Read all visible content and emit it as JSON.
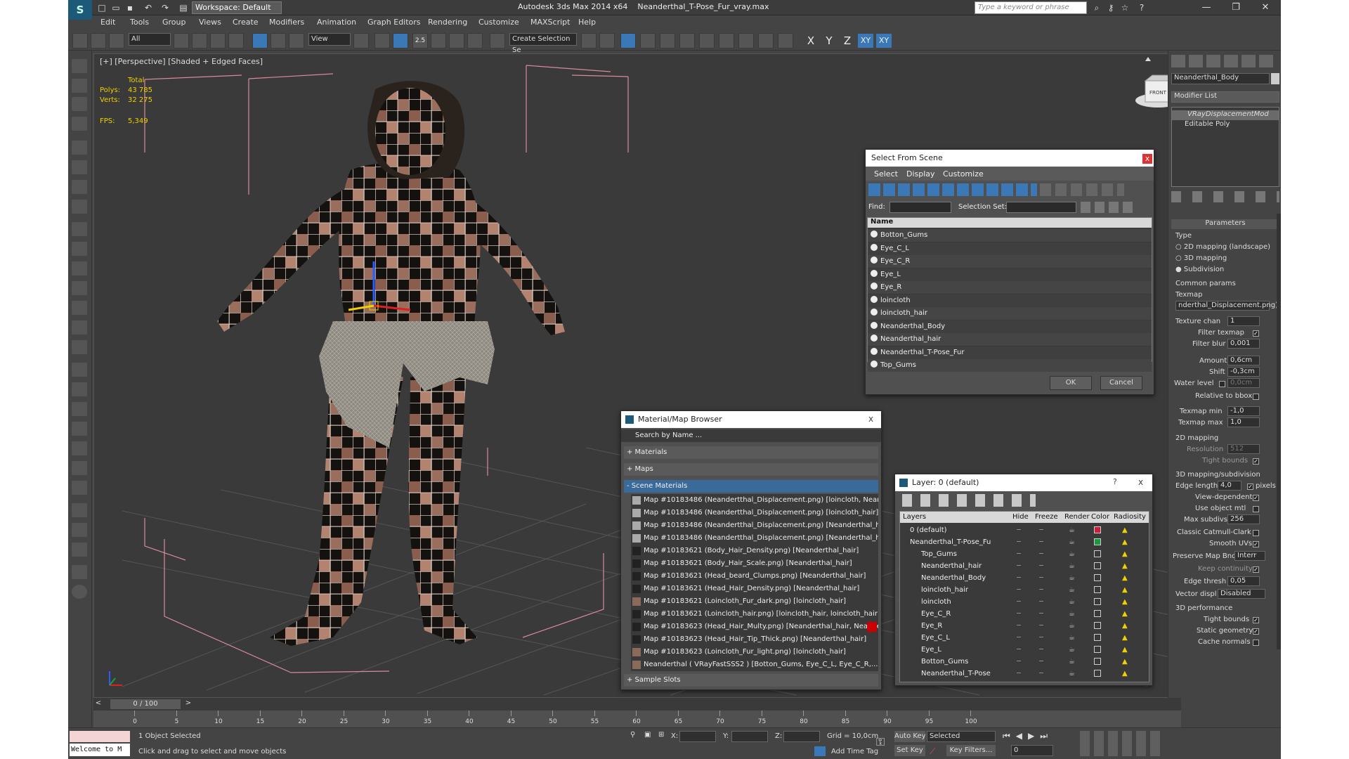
{
  "title_bar": {
    "app": "Autodesk 3ds Max  2014 x64",
    "file": "Neanderthal_T-Pose_Fur_vray.max",
    "workspace": "Workspace: Default",
    "search_placeholder": "Type a keyword or phrase"
  },
  "menu": [
    "Edit",
    "Tools",
    "Group",
    "Views",
    "Create",
    "Modifiers",
    "Animation",
    "Graph Editors",
    "Rendering",
    "Customize",
    "MAXScript",
    "Help"
  ],
  "toolbar": {
    "filter": "All",
    "ref_coord": "View",
    "angle_snap": "2.5",
    "selection_set": "Create Selection Se",
    "axes": [
      "X",
      "Y",
      "Z",
      "XY",
      "XY"
    ]
  },
  "viewport": {
    "label": "[+] [Perspective] [Shaded + Edged Faces]",
    "stats": {
      "header": "Total",
      "polys_label": "Polys:",
      "polys": "43 785",
      "verts_label": "Verts:",
      "verts": "32 275",
      "fps_label": "FPS:",
      "fps": "5,349"
    },
    "viewcube": "FRONT"
  },
  "select_from_scene": {
    "title": "Select From Scene",
    "close": "x",
    "menu": [
      "Select",
      "Display",
      "Customize"
    ],
    "find_label": "Find:",
    "selset_label": "Selection Set:",
    "column": "Name",
    "items": [
      "Botton_Gums",
      "Eye_C_L",
      "Eye_C_R",
      "Eye_L",
      "Eye_R",
      "loincloth",
      "loincloth_hair",
      "Neanderthal_Body",
      "Neanderthal_hair",
      "Neanderthal_T-Pose_Fur",
      "Top_Gums"
    ],
    "ok": "OK",
    "cancel": "Cancel"
  },
  "material_browser": {
    "title": "Material/Map Browser",
    "close": "x",
    "search": "Search by Name ...",
    "groups": [
      "+ Materials",
      "+ Maps",
      "- Scene Materials"
    ],
    "items": [
      "Map #10183486 (Neandertthal_Displacement.png) [loincloth, Nean...",
      "Map #10183486 (Neandertthal_Displacement.png) [loincloth_hair]",
      "Map #10183486 (Neandertthal_Displacement.png) [Neanderthal_ha...",
      "Map #10183486 (Neandertthal_Displacement.png) [Neanderthal_ha...",
      "Map #10183621 (Body_Hair_Density.png) [Neanderthal_hair]",
      "Map #10183621 (Body_Hair_Scale.png) [Neanderthal_hair]",
      "Map #10183621 (Head_beard_Clumps.png) [Neanderthal_hair]",
      "Map #10183621 (Head_Hair_Density.png) [Neanderthal_hair]",
      "Map #10183621 (Loincloth_Fur_dark.png) [loincloth_hair]",
      "Map #10183621 (Loincloth_hair.png) [loincloth_hair, loincloth_hair]",
      "Map #10183623 (Head_Hair_Multy.png) [Neanderthal_hair, Neande...",
      "Map #10183623 (Head_Hair_Tip_Thick.png) [Neanderthal_hair]",
      "Map #10183623 (Loincloth_Fur_light.png) [loincloth_hair]",
      "Neanderthal  ( VRayFastSSS2 )  [Botton_Gums, Eye_C_L, Eye_C_R,..."
    ],
    "sample_slots": "+ Sample Slots"
  },
  "layer_dialog": {
    "title": "Layer: 0 (default)",
    "help": "?",
    "close": "x",
    "columns": [
      "Layers",
      "Hide",
      "Freeze",
      "Render",
      "Color",
      "Radiosity"
    ],
    "rows": [
      {
        "name": "0 (default)",
        "color": "#c8203c"
      },
      {
        "name": "Neanderthal_T-Pose_Fu",
        "color": "#1a9a3a"
      },
      {
        "name": "Top_Gums",
        "color": ""
      },
      {
        "name": "Neanderthal_hair",
        "color": ""
      },
      {
        "name": "Neanderthal_Body",
        "color": ""
      },
      {
        "name": "loincloth_hair",
        "color": ""
      },
      {
        "name": "loincloth",
        "color": ""
      },
      {
        "name": "Eye_C_R",
        "color": ""
      },
      {
        "name": "Eye_R",
        "color": ""
      },
      {
        "name": "Eye_C_L",
        "color": ""
      },
      {
        "name": "Eye_L",
        "color": ""
      },
      {
        "name": "Botton_Gums",
        "color": ""
      },
      {
        "name": "Neanderthal_T-Pose",
        "color": ""
      }
    ]
  },
  "command_panel": {
    "object_name": "Neanderthal_Body",
    "modifier_list": "Modifier List",
    "stack": [
      "VRayDisplacementMod",
      "Editable Poly"
    ],
    "parameters": "Parameters",
    "type_label": "Type",
    "type_options": [
      "2D mapping (landscape)",
      "3D mapping",
      "Subdivision"
    ],
    "common_params": "Common params",
    "texmap_label": "Texmap",
    "texmap": "nderthal_Displacement.png)",
    "texture_chan_label": "Texture chan",
    "texture_chan": "1",
    "filter_texmap": "Filter texmap",
    "filter_blur_label": "Filter blur",
    "filter_blur": "0,001",
    "amount_label": "Amount",
    "amount": "0,6cm",
    "shift_label": "Shift",
    "shift": "-0,3cm",
    "water_level_label": "Water level",
    "water_level": "0,0cm",
    "relative_bbox": "Relative to bbox",
    "texmap_min_label": "Texmap min",
    "texmap_min": "-1,0",
    "texmap_max_label": "Texmap max",
    "texmap_max": "1,0",
    "mapping2d": "2D mapping",
    "resolution_label": "Resolution",
    "resolution": "512",
    "tight_bounds": "Tight bounds",
    "mapping3d": "3D mapping/subdivision",
    "edge_length_label": "Edge length",
    "edge_length": "4,0",
    "pixels": "pixels",
    "view_dependent": "View-dependent",
    "use_object_mtl": "Use object mtl",
    "max_subdivs_label": "Max subdivs",
    "max_subdivs": "256",
    "catmull": "Classic Catmull-Clark",
    "smooth_uvs": "Smooth UVs",
    "preserve_label": "Preserve Map Bnd",
    "preserve": "Interr",
    "keep_continuity": "Keep continuity",
    "edge_thresh_label": "Edge thresh",
    "edge_thresh": "0,05",
    "vector_displ_label": "Vector displ",
    "vector_displ": "Disabled",
    "perf": "3D performance",
    "perf_tight": "Tight bounds",
    "static_geom": "Static geometry",
    "cache_normals": "Cache normals"
  },
  "timeline": {
    "frame": "0 / 100",
    "ticks": [
      "0",
      "5",
      "10",
      "15",
      "20",
      "25",
      "30",
      "35",
      "40",
      "45",
      "50",
      "55",
      "60",
      "65",
      "70",
      "75",
      "80",
      "85",
      "90",
      "95",
      "100"
    ]
  },
  "status": {
    "script_listener": "Welcome to M",
    "selection": "1 Object Selected",
    "prompt": "Click and drag to select and move objects",
    "x_label": "X:",
    "y_label": "Y:",
    "z_label": "Z:",
    "grid": "Grid = 10,0cm",
    "auto_key": "Auto Key",
    "selected": "Selected",
    "set_key": "Set Key",
    "key_filters": "Key Filters...",
    "add_time_tag": "Add Time Tag",
    "frame_value": "0"
  }
}
